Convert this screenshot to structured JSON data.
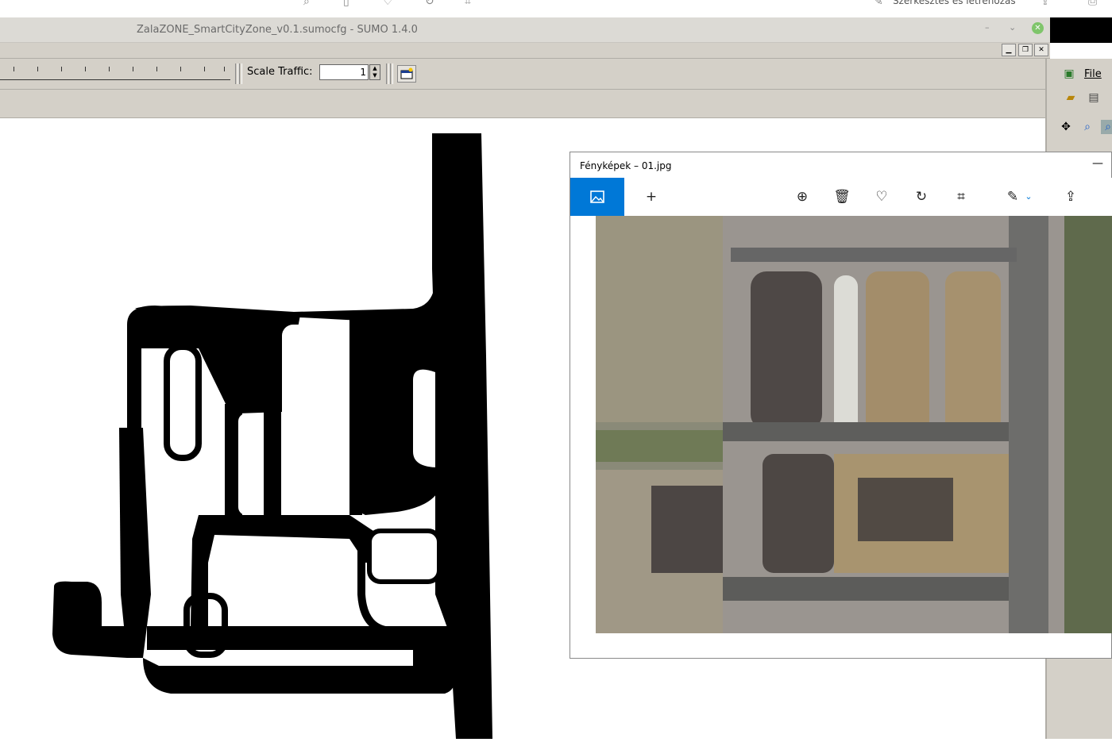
{
  "background_window": {
    "edit_label": "Szerkesztés és létrehozás"
  },
  "sumo": {
    "title": "ZalaZONE_SmartCityZone_v0.1.sumocfg - SUMO 1.4.0",
    "window_buttons": {
      "minimize": "–",
      "restore": "⌄",
      "close": "✕"
    },
    "mdi_buttons": {
      "minimize": "▁",
      "restore": "❐",
      "close": "✕"
    },
    "scale_traffic_label": "Scale Traffic:",
    "scale_traffic_value": "1",
    "menu": {
      "file": "File"
    }
  },
  "photos": {
    "title": "Fényképek – 01.jpg",
    "minimize": "—",
    "toolbar": {
      "add": "+",
      "zoom": "zoom-in-icon",
      "delete": "trash-icon",
      "favorite": "heart-icon",
      "rotate": "rotate-icon",
      "crop": "crop-icon",
      "edit": "edit-create-icon",
      "share": "share-icon"
    }
  },
  "colors": {
    "photos_accent": "#0078d7",
    "sumo_chrome": "#d4d0c8",
    "network_road": "#000000"
  }
}
